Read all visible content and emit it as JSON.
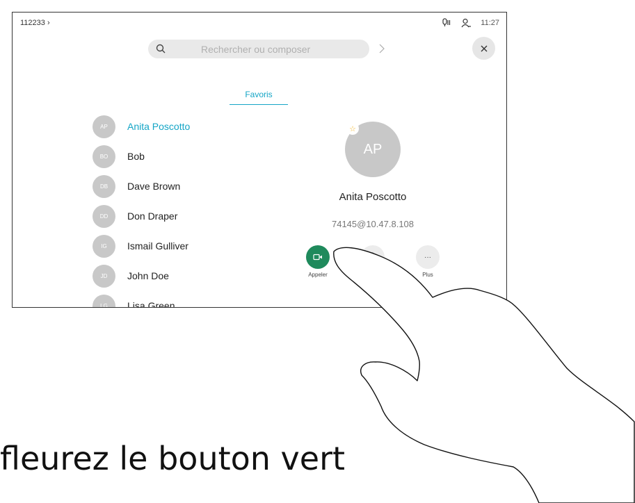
{
  "status": {
    "room_id": "112233 ›",
    "time": "11:27"
  },
  "search": {
    "placeholder": "Rechercher ou composer"
  },
  "tabs": [
    {
      "label": "Favoris"
    }
  ],
  "contacts": [
    {
      "initials": "AP",
      "name": "Anita Poscotto"
    },
    {
      "initials": "BO",
      "name": "Bob"
    },
    {
      "initials": "DB",
      "name": "Dave Brown"
    },
    {
      "initials": "DD",
      "name": "Don Draper"
    },
    {
      "initials": "IG",
      "name": "Ismail Gulliver"
    },
    {
      "initials": "JD",
      "name": "John Doe"
    },
    {
      "initials": "LG",
      "name": "Lisa Green"
    }
  ],
  "selected": {
    "initials": "AP",
    "name": "Anita Poscotto",
    "address": "74145@10.47.8.108"
  },
  "actions": {
    "call_label": "Appeler",
    "more_label": "Plus",
    "more_icon": "···"
  },
  "instruction": "fleurez le bouton vert",
  "colors": {
    "accent": "#14a5c6",
    "call_green": "#1f8a5c",
    "favorite_star": "#f2b72d"
  }
}
